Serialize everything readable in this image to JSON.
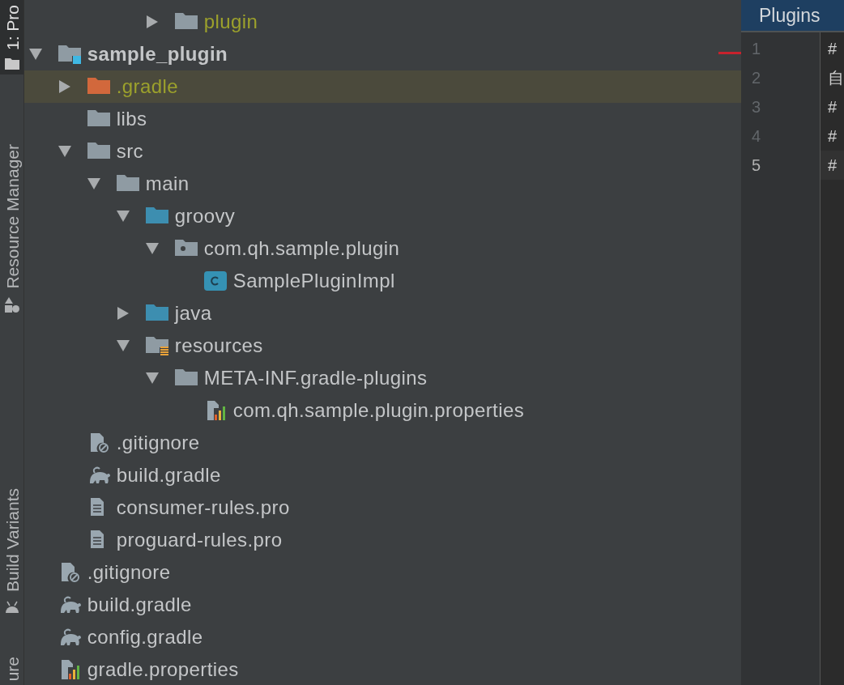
{
  "tool_window_bar": {
    "tabs": [
      {
        "label": "1: Pro",
        "selected": true,
        "kind": "project"
      },
      {
        "label": "Resource Manager",
        "selected": false,
        "kind": "resources"
      },
      {
        "label": "Build Variants",
        "selected": false,
        "kind": "android"
      },
      {
        "label": "ure",
        "selected": false,
        "kind": "none"
      }
    ]
  },
  "project_tree": {
    "items": [
      {
        "children": [
          {
            "children": [
              {
                "children": [
                  {
                    "children": [
                      {
                        "label": "plugin",
                        "kind": "folder",
                        "expanded": false,
                        "ignored": true,
                        "selected": false
                      }
                    ]
                  }
                ]
              }
            ]
          }
        ]
      },
      {
        "label": "sample_plugin",
        "kind": "module",
        "expanded": true,
        "ignored": false,
        "selected": false,
        "children": [
          {
            "label": ".gradle",
            "kind": "folder-excluded",
            "expanded": false,
            "ignored": true,
            "selected": true
          },
          {
            "label": "libs",
            "kind": "folder",
            "ignored": false,
            "selected": false
          },
          {
            "label": "src",
            "kind": "folder",
            "expanded": true,
            "ignored": false,
            "selected": false,
            "children": [
              {
                "label": "main",
                "kind": "folder",
                "expanded": true,
                "ignored": false,
                "selected": false,
                "children": [
                  {
                    "label": "groovy",
                    "kind": "folder-source",
                    "expanded": true,
                    "ignored": false,
                    "selected": false,
                    "children": [
                      {
                        "label": "com.qh.sample.plugin",
                        "kind": "package",
                        "expanded": true,
                        "ignored": false,
                        "selected": false,
                        "children": [
                          {
                            "label": "SamplePluginImpl",
                            "kind": "class",
                            "ignored": false,
                            "selected": false
                          }
                        ]
                      }
                    ]
                  },
                  {
                    "label": "java",
                    "kind": "folder-source",
                    "expanded": false,
                    "ignored": false,
                    "selected": false
                  },
                  {
                    "label": "resources",
                    "kind": "folder-resources",
                    "expanded": true,
                    "ignored": false,
                    "selected": false,
                    "children": [
                      {
                        "label": "META-INF.gradle-plugins",
                        "kind": "folder",
                        "expanded": true,
                        "ignored": false,
                        "selected": false,
                        "children": [
                          {
                            "label": "com.qh.sample.plugin.properties",
                            "kind": "properties",
                            "ignored": false,
                            "selected": false
                          }
                        ]
                      }
                    ]
                  }
                ]
              }
            ]
          },
          {
            "label": ".gitignore",
            "kind": "ignore-file",
            "ignored": false,
            "selected": false
          },
          {
            "label": "build.gradle",
            "kind": "gradle",
            "ignored": false,
            "selected": false
          },
          {
            "label": "consumer-rules.pro",
            "kind": "text-file",
            "ignored": false,
            "selected": false
          },
          {
            "label": "proguard-rules.pro",
            "kind": "text-file",
            "ignored": false,
            "selected": false
          }
        ]
      },
      {
        "label": ".gitignore",
        "kind": "ignore-file",
        "ignored": false,
        "selected": false
      },
      {
        "label": "build.gradle",
        "kind": "gradle",
        "ignored": false,
        "selected": false
      },
      {
        "label": "config.gradle",
        "kind": "gradle",
        "ignored": false,
        "selected": false
      },
      {
        "label": "gradle.properties",
        "kind": "properties",
        "ignored": false,
        "selected": false
      }
    ]
  },
  "editor": {
    "tab": {
      "title": "Plugins",
      "selected": true
    },
    "lines": [
      {
        "number": "1",
        "text": "#",
        "current": false
      },
      {
        "number": "2",
        "text": "自",
        "current": false
      },
      {
        "number": "3",
        "text": "#",
        "current": false
      },
      {
        "number": "4",
        "text": "#",
        "current": false
      },
      {
        "number": "5",
        "text": "#",
        "current": true
      }
    ]
  }
}
